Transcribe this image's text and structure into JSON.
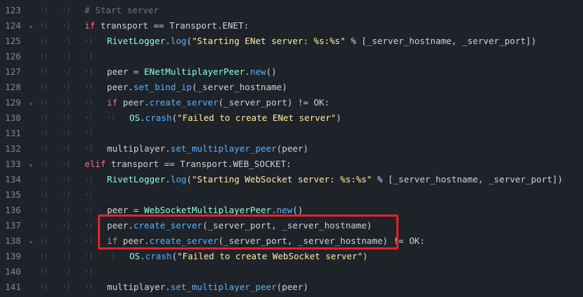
{
  "editor": {
    "lines": [
      {
        "num": "123",
        "fold": "",
        "tabs": 2,
        "indent": 2,
        "tokens": [
          {
            "t": "# Start server",
            "c": "cm"
          }
        ]
      },
      {
        "num": "124",
        "fold": "v",
        "tabs": 2,
        "indent": 2,
        "tokens": [
          {
            "t": "if",
            "c": "kw"
          },
          {
            "t": " transport == ",
            "c": "op"
          },
          {
            "t": "Transport",
            "c": "op"
          },
          {
            "t": ".ENET:",
            "c": "op"
          }
        ]
      },
      {
        "num": "125",
        "fold": "",
        "tabs": 3,
        "indent": 3,
        "tokens": [
          {
            "t": "RivetLogger",
            "c": "cls"
          },
          {
            "t": ".",
            "c": "op"
          },
          {
            "t": "log",
            "c": "fn"
          },
          {
            "t": "(",
            "c": "op"
          },
          {
            "t": "\"Starting ENet server: %s:%s\"",
            "c": "str"
          },
          {
            "t": " % [_server_hostname, _server_port])",
            "c": "op"
          }
        ]
      },
      {
        "num": "126",
        "fold": "",
        "tabs": 3,
        "indent": 3,
        "tokens": []
      },
      {
        "num": "127",
        "fold": "",
        "tabs": 3,
        "indent": 3,
        "tokens": [
          {
            "t": "peer = ",
            "c": "op"
          },
          {
            "t": "ENetMultiplayerPeer",
            "c": "cls"
          },
          {
            "t": ".",
            "c": "op"
          },
          {
            "t": "new",
            "c": "fn"
          },
          {
            "t": "()",
            "c": "op"
          }
        ]
      },
      {
        "num": "128",
        "fold": "",
        "tabs": 3,
        "indent": 3,
        "tokens": [
          {
            "t": "peer.",
            "c": "op"
          },
          {
            "t": "set_bind_ip",
            "c": "fn"
          },
          {
            "t": "(_server_hostname)",
            "c": "op"
          }
        ]
      },
      {
        "num": "129",
        "fold": "v",
        "tabs": 3,
        "indent": 3,
        "tokens": [
          {
            "t": "if",
            "c": "kw"
          },
          {
            "t": " peer.",
            "c": "op"
          },
          {
            "t": "create_server",
            "c": "fn"
          },
          {
            "t": "(_server_port) != OK:",
            "c": "op"
          }
        ]
      },
      {
        "num": "130",
        "fold": "",
        "tabs": 4,
        "indent": 4,
        "tokens": [
          {
            "t": "OS",
            "c": "cls"
          },
          {
            "t": ".",
            "c": "op"
          },
          {
            "t": "crash",
            "c": "fn"
          },
          {
            "t": "(",
            "c": "op"
          },
          {
            "t": "\"Failed to create ENet server\"",
            "c": "str"
          },
          {
            "t": ")",
            "c": "op"
          }
        ]
      },
      {
        "num": "131",
        "fold": "",
        "tabs": 3,
        "indent": 3,
        "tokens": []
      },
      {
        "num": "132",
        "fold": "",
        "tabs": 3,
        "indent": 3,
        "tokens": [
          {
            "t": "multiplayer.",
            "c": "op"
          },
          {
            "t": "set_multiplayer_peer",
            "c": "fn"
          },
          {
            "t": "(peer)",
            "c": "op"
          }
        ]
      },
      {
        "num": "133",
        "fold": "v",
        "tabs": 2,
        "indent": 2,
        "tokens": [
          {
            "t": "elif",
            "c": "kw"
          },
          {
            "t": " transport == ",
            "c": "op"
          },
          {
            "t": "Transport",
            "c": "op"
          },
          {
            "t": ".WEB_SOCKET:",
            "c": "op"
          }
        ]
      },
      {
        "num": "134",
        "fold": "",
        "tabs": 3,
        "indent": 3,
        "tokens": [
          {
            "t": "RivetLogger",
            "c": "cls"
          },
          {
            "t": ".",
            "c": "op"
          },
          {
            "t": "log",
            "c": "fn"
          },
          {
            "t": "(",
            "c": "op"
          },
          {
            "t": "\"Starting WebSocket server: %s:%s\"",
            "c": "str"
          },
          {
            "t": " % [_server_hostname, _server_port])",
            "c": "op"
          }
        ]
      },
      {
        "num": "135",
        "fold": "",
        "tabs": 3,
        "indent": 3,
        "tokens": []
      },
      {
        "num": "136",
        "fold": "",
        "tabs": 3,
        "indent": 3,
        "tokens": [
          {
            "t": "peer = ",
            "c": "op"
          },
          {
            "t": "WebSocketMultiplayerPeer",
            "c": "cls"
          },
          {
            "t": ".",
            "c": "op"
          },
          {
            "t": "new",
            "c": "fn"
          },
          {
            "t": "()",
            "c": "op"
          }
        ]
      },
      {
        "num": "137",
        "fold": "",
        "tabs": 3,
        "indent": 3,
        "tokens": [
          {
            "t": "peer.",
            "c": "op"
          },
          {
            "t": "create_server",
            "c": "fn"
          },
          {
            "t": "(_server_port, _server_hostname)",
            "c": "op"
          }
        ]
      },
      {
        "num": "138",
        "fold": "v",
        "tabs": 3,
        "indent": 3,
        "tokens": [
          {
            "t": "if",
            "c": "kw"
          },
          {
            "t": " peer.",
            "c": "op"
          },
          {
            "t": "create_server",
            "c": "fn"
          },
          {
            "t": "(_server_port, _server_hostname) != OK:",
            "c": "op"
          }
        ]
      },
      {
        "num": "139",
        "fold": "",
        "tabs": 4,
        "indent": 4,
        "tokens": [
          {
            "t": "OS",
            "c": "cls"
          },
          {
            "t": ".",
            "c": "op"
          },
          {
            "t": "crash",
            "c": "fn"
          },
          {
            "t": "(",
            "c": "op"
          },
          {
            "t": "\"Failed to create WebSocket server\"",
            "c": "str"
          },
          {
            "t": ")",
            "c": "op"
          }
        ]
      },
      {
        "num": "140",
        "fold": "",
        "tabs": 3,
        "indent": 3,
        "tokens": []
      },
      {
        "num": "141",
        "fold": "",
        "tabs": 3,
        "indent": 3,
        "tokens": [
          {
            "t": "multiplayer.",
            "c": "op"
          },
          {
            "t": "set_multiplayer_peer",
            "c": "fn"
          },
          {
            "t": "(peer)",
            "c": "op"
          }
        ]
      }
    ]
  },
  "icons": {
    "tab_glyph": "›|",
    "fold_glyph": "⌄"
  },
  "colors": {
    "background": "#1e2229",
    "highlight_border": "#e8202a",
    "keyword": "#ff7085",
    "function": "#57b3ff",
    "class": "#8effda",
    "string": "#ffeda1",
    "comment": "#6c7585"
  }
}
